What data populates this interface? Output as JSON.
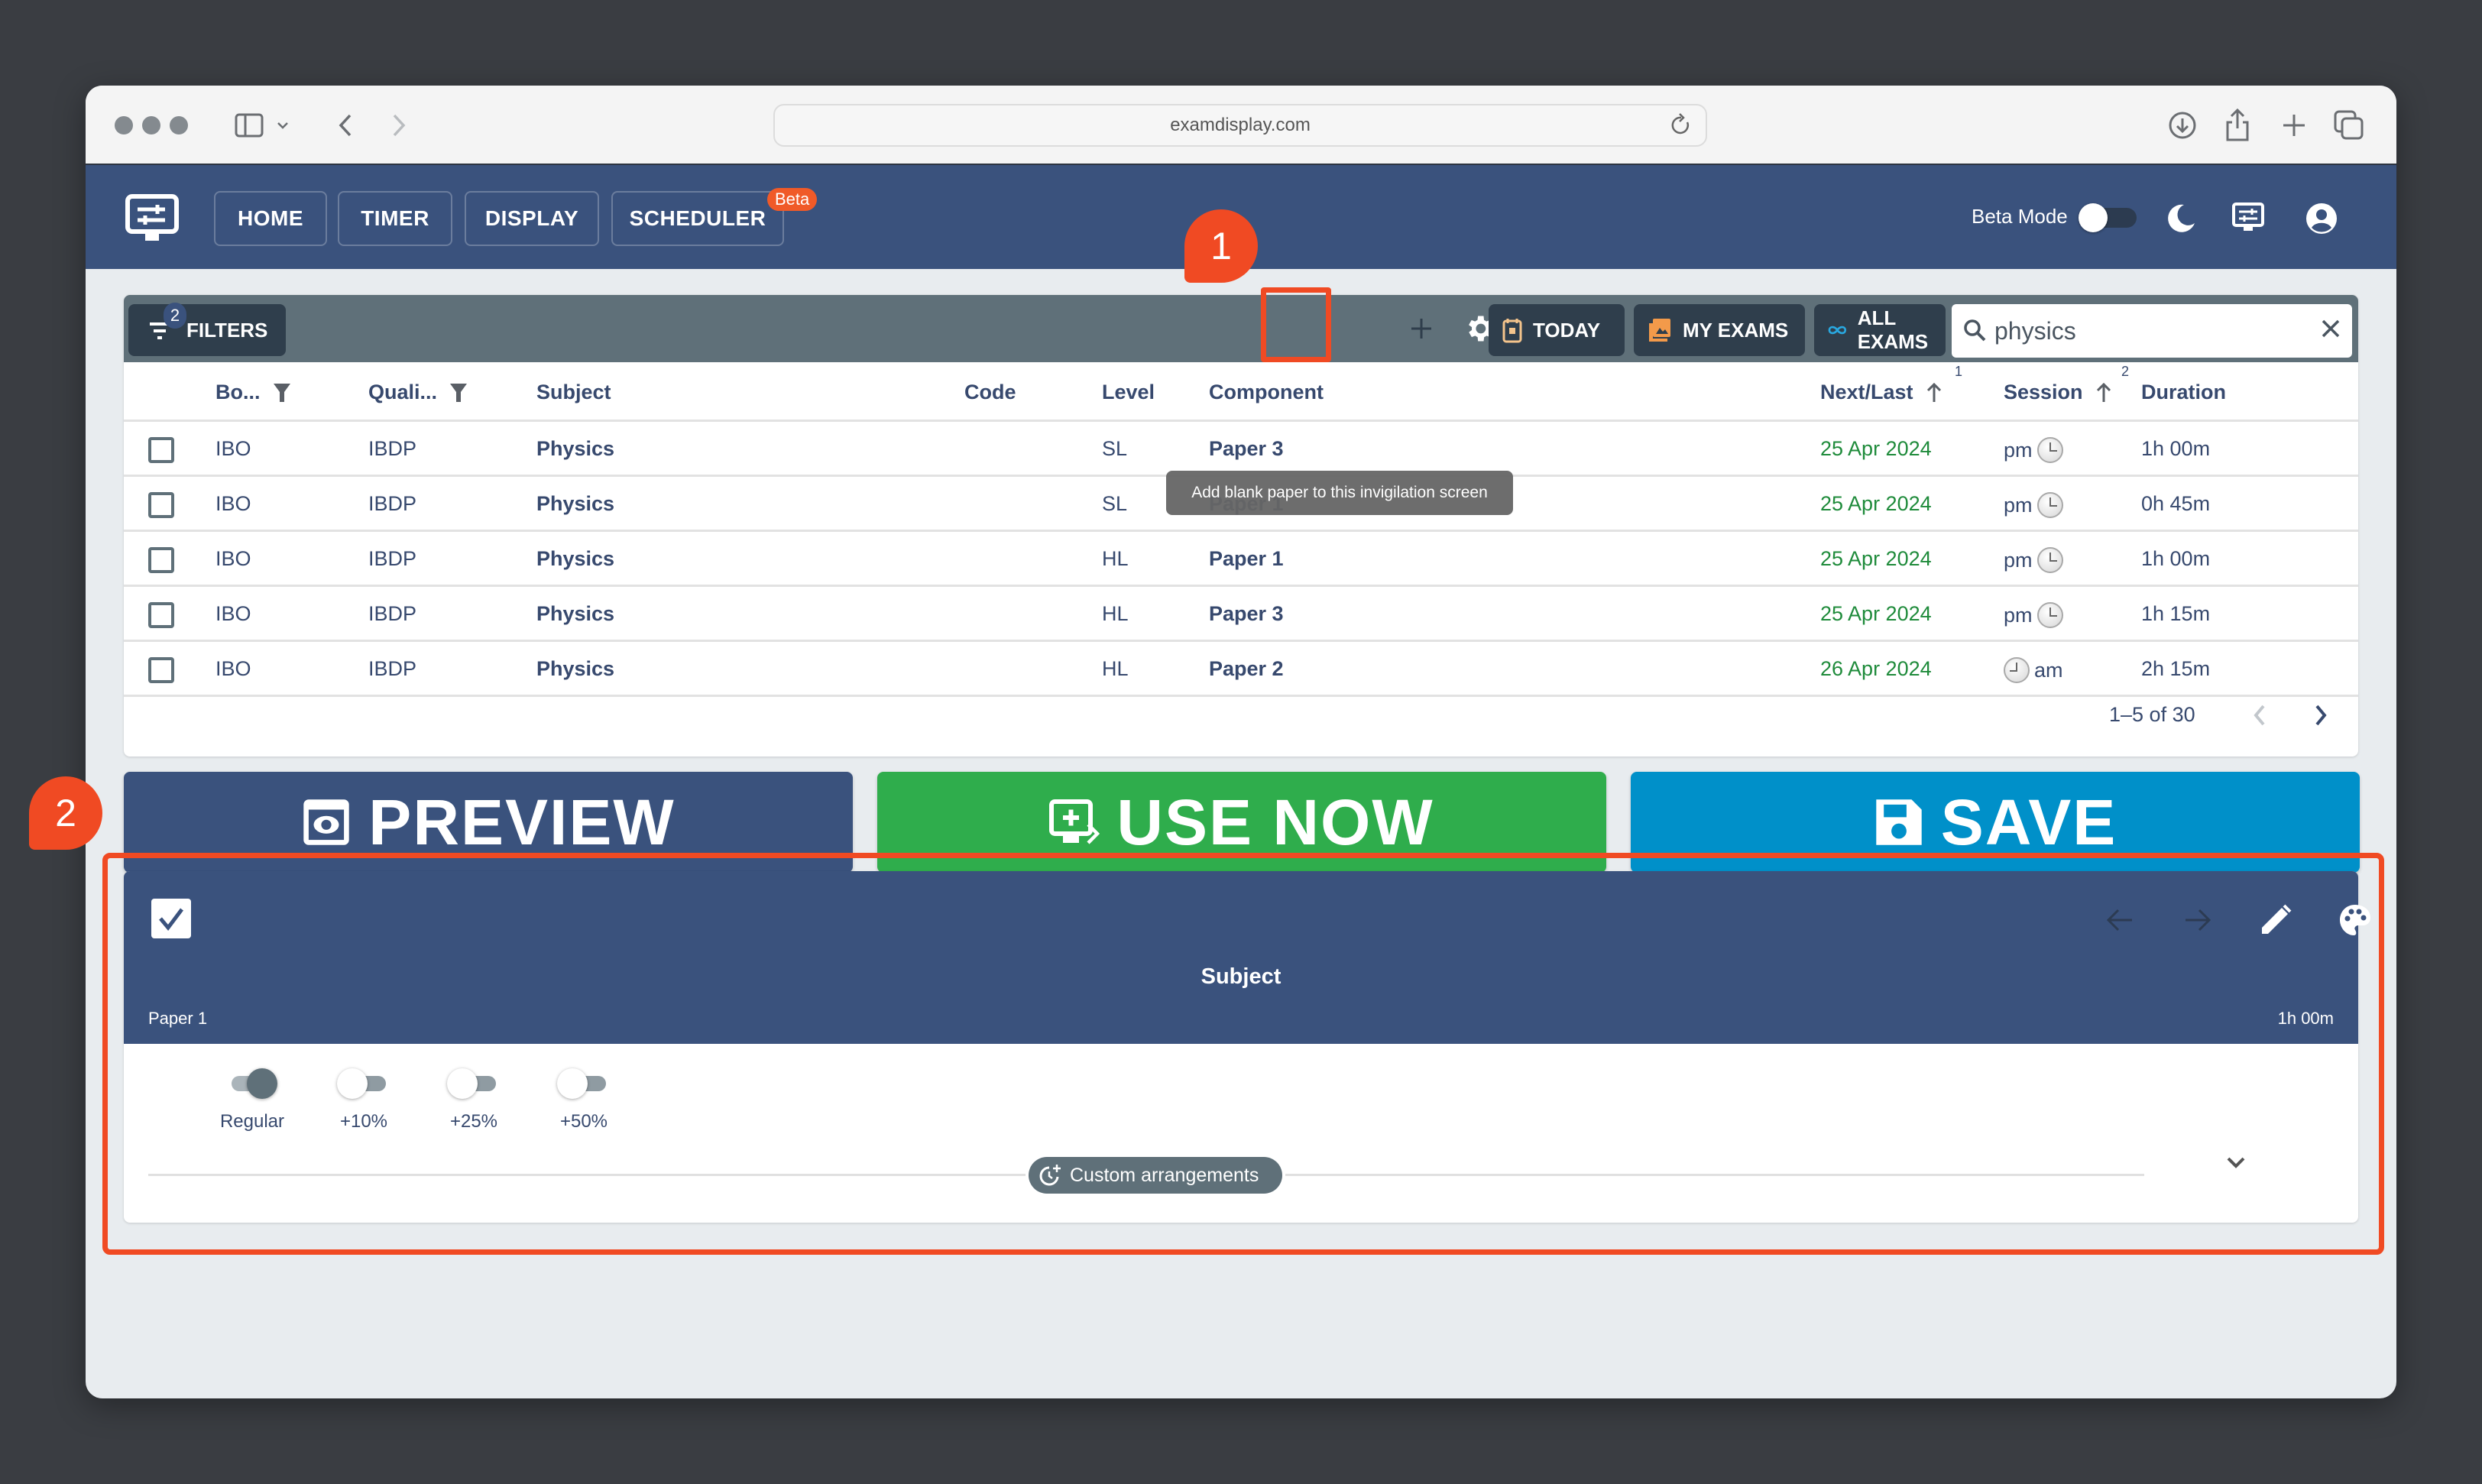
{
  "browser": {
    "url": "examdisplay.com"
  },
  "appbar": {
    "nav": [
      {
        "label": "HOME"
      },
      {
        "label": "TIMER"
      },
      {
        "label": "DISPLAY"
      },
      {
        "label": "SCHEDULER"
      }
    ],
    "beta_badge": "Beta",
    "beta_mode_label": "Beta Mode",
    "beta_mode_on": false
  },
  "toolbar": {
    "filters_label": "FILTERS",
    "filters_count": "2",
    "today_label": "TODAY",
    "my_exams_label": "MY EXAMS",
    "all_exams_label": "ALL EXAMS",
    "search_value": "physics",
    "tooltip": "Add blank paper to this invigilation screen"
  },
  "table": {
    "headers": {
      "board": "Bo...",
      "qualification": "Quali...",
      "subject": "Subject",
      "code": "Code",
      "level": "Level",
      "component": "Component",
      "next_last": "Next/Last",
      "next_last_sort": "1",
      "session": "Session",
      "session_sort": "2",
      "duration": "Duration"
    },
    "rows": [
      {
        "board": "IBO",
        "qualification": "IBDP",
        "subject": "Physics",
        "code": "",
        "level": "SL",
        "component": "Paper 3",
        "date": "25 Apr 2024",
        "session": "pm",
        "duration": "1h 00m"
      },
      {
        "board": "IBO",
        "qualification": "IBDP",
        "subject": "Physics",
        "code": "",
        "level": "SL",
        "component": "Paper 1",
        "date": "25 Apr 2024",
        "session": "pm",
        "duration": "0h 45m"
      },
      {
        "board": "IBO",
        "qualification": "IBDP",
        "subject": "Physics",
        "code": "",
        "level": "HL",
        "component": "Paper 1",
        "date": "25 Apr 2024",
        "session": "pm",
        "duration": "1h 00m"
      },
      {
        "board": "IBO",
        "qualification": "IBDP",
        "subject": "Physics",
        "code": "",
        "level": "HL",
        "component": "Paper 3",
        "date": "25 Apr 2024",
        "session": "pm",
        "duration": "1h 15m"
      },
      {
        "board": "IBO",
        "qualification": "IBDP",
        "subject": "Physics",
        "code": "",
        "level": "HL",
        "component": "Paper 2",
        "date": "26 Apr 2024",
        "session": "am",
        "duration": "2h 15m"
      }
    ],
    "pagination": "1–5 of 30"
  },
  "actions": {
    "preview_label": "PREVIEW",
    "use_now_label": "USE NOW",
    "save_label": "SAVE"
  },
  "paper_card": {
    "checked": true,
    "subject": "Subject",
    "component": "Paper 1",
    "duration": "1h 00m",
    "time_options": [
      {
        "label": "Regular",
        "on": true
      },
      {
        "label": "+10%",
        "on": false
      },
      {
        "label": "+25%",
        "on": false
      },
      {
        "label": "+50%",
        "on": false
      }
    ],
    "custom_arrangements_label": "Custom arrangements"
  },
  "annotations": {
    "callout_1": "1",
    "callout_2": "2"
  },
  "colors": {
    "header_blue": "#3a527d",
    "toolbar_grey": "#5f7079",
    "use_now_green": "#2fad4c",
    "save_blue": "#0090c9",
    "date_green": "#1f8b3b",
    "annotation_red": "#f04a23",
    "beta_orange": "#f05a28"
  }
}
